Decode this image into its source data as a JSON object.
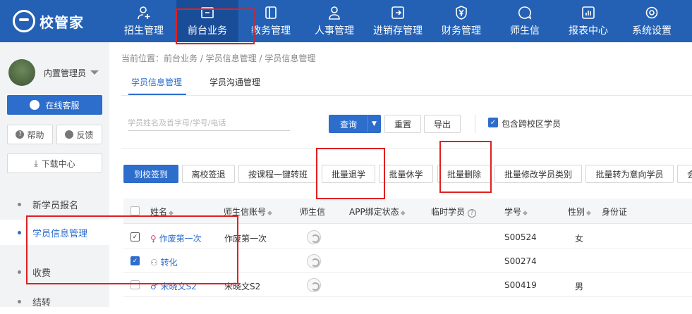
{
  "app": {
    "logo_text": "校管家"
  },
  "nav": [
    {
      "label": "招生管理",
      "icon": "person-add-icon"
    },
    {
      "label": "前台业务",
      "icon": "monitor-icon",
      "active": true
    },
    {
      "label": "教务管理",
      "icon": "book-icon"
    },
    {
      "label": "人事管理",
      "icon": "person-icon"
    },
    {
      "label": "进销存管理",
      "icon": "box-arrow-icon"
    },
    {
      "label": "财务管理",
      "icon": "yen-shield-icon"
    },
    {
      "label": "师生信",
      "icon": "chat-bubble-icon"
    },
    {
      "label": "报表中心",
      "icon": "chart-icon"
    },
    {
      "label": "系统设置",
      "icon": "gear-icon"
    }
  ],
  "sidebar": {
    "username": "内置管理员",
    "service_label": "在线客服",
    "help_label": "帮助",
    "feedback_label": "反馈",
    "download_label": "下载中心",
    "menu": [
      "新学员报名",
      "学员信息管理",
      "收费",
      "结转"
    ],
    "active_menu": "学员信息管理"
  },
  "breadcrumb": "当前位置：前台业务 / 学员信息管理 / 学员信息管理",
  "tabs": [
    "学员信息管理",
    "学员沟通管理"
  ],
  "search": {
    "placeholder": "学员姓名及首字母/学号/电话"
  },
  "filter_buttons": {
    "query": "查询",
    "reset": "重置",
    "export": "导出",
    "cross_campus": "包含跨校区学员"
  },
  "actions": [
    "到校签到",
    "离校签退",
    "按课程一键转班",
    "批量退学",
    "批量休学",
    "批量删除",
    "批量修改学员类别",
    "批量转为意向学员",
    "会"
  ],
  "table": {
    "columns": [
      "姓名",
      "师生信账号",
      "师生信",
      "APP绑定状态",
      "临时学员",
      "学号",
      "性别",
      "身份证"
    ],
    "rows": [
      {
        "name": "作废第一次",
        "account": "作废第一次",
        "student_no": "S00524",
        "gender": "女",
        "gender_icon": "female-icon",
        "checked": true
      },
      {
        "name": "转化",
        "account": "",
        "student_no": "S00274",
        "gender": "",
        "gender_icon": "person-icon",
        "checked": true
      },
      {
        "name": "宋晓文S2",
        "account": "宋晓文S2",
        "student_no": "S00419",
        "gender": "男",
        "gender_icon": "male-icon",
        "checked": false
      }
    ]
  },
  "colors": {
    "nav_bg": "#2461b4",
    "accent": "#2d6dcc",
    "highlight": "#e02020"
  }
}
